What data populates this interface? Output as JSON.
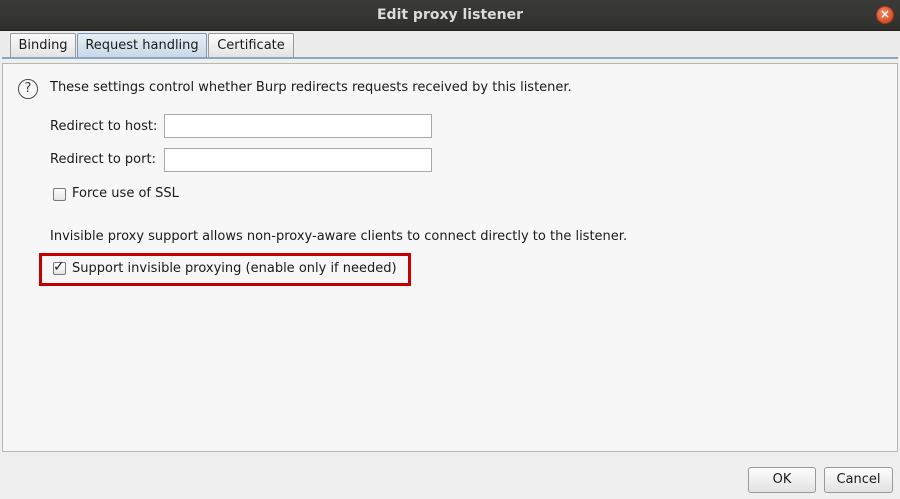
{
  "window": {
    "title": "Edit proxy listener",
    "close_glyph": "×"
  },
  "tabs": [
    {
      "label": "Binding",
      "active": false
    },
    {
      "label": "Request handling",
      "active": true
    },
    {
      "label": "Certificate",
      "active": false
    }
  ],
  "request_handling": {
    "description": "These settings control whether Burp redirects requests received by this listener.",
    "help_icon": "question-circle-icon",
    "redirect_host": {
      "label": "Redirect to host:",
      "value": ""
    },
    "redirect_port": {
      "label": "Redirect to port:",
      "value": ""
    },
    "force_ssl": {
      "label": "Force use of SSL",
      "checked": false
    },
    "invisible_description": "Invisible proxy support allows non-proxy-aware clients to connect directly to the listener.",
    "invisible_proxying": {
      "label": "Support invisible proxying (enable only if needed)",
      "checked": true
    }
  },
  "footer": {
    "ok_label": "OK",
    "cancel_label": "Cancel"
  },
  "colors": {
    "titlebar": "#2f2f2c",
    "close_button": "#e0552d",
    "highlight_border": "#c40000",
    "active_tab": "#c9d9e8"
  }
}
